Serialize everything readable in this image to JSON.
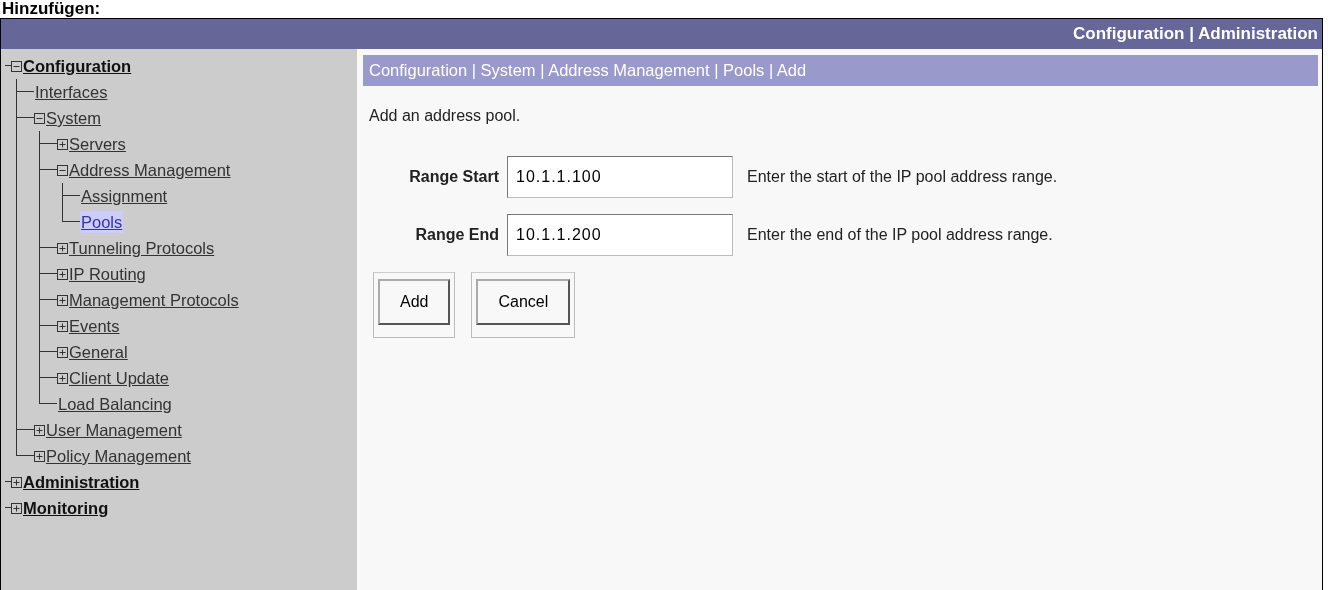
{
  "caption": "Hinzufügen:",
  "header": {
    "text": "Configuration | Administration"
  },
  "tree": [
    {
      "label": "Configuration",
      "selected": false,
      "expanded": true,
      "children": [
        {
          "label": "Interfaces",
          "selected": false
        },
        {
          "label": "System",
          "selected": false,
          "expanded": true,
          "children": [
            {
              "label": "Servers",
              "selected": false,
              "expanded": false
            },
            {
              "label": "Address Management",
              "selected": false,
              "expanded": true,
              "children": [
                {
                  "label": "Assignment",
                  "selected": false
                },
                {
                  "label": "Pools",
                  "selected": true
                }
              ]
            },
            {
              "label": "Tunneling Protocols",
              "selected": false,
              "expanded": false
            },
            {
              "label": "IP Routing",
              "selected": false,
              "expanded": false
            },
            {
              "label": "Management Protocols",
              "selected": false,
              "expanded": false
            },
            {
              "label": "Events",
              "selected": false,
              "expanded": false
            },
            {
              "label": "General",
              "selected": false,
              "expanded": false
            },
            {
              "label": "Client Update",
              "selected": false,
              "expanded": false
            },
            {
              "label": "Load Balancing",
              "selected": false
            }
          ]
        },
        {
          "label": "User Management",
          "selected": false,
          "expanded": false
        },
        {
          "label": "Policy Management",
          "selected": false,
          "expanded": false
        }
      ]
    },
    {
      "label": "Administration",
      "selected": false,
      "expanded": false
    },
    {
      "label": "Monitoring",
      "selected": false,
      "expanded": false
    }
  ],
  "breadcrumb": "Configuration | System | Address Management | Pools | Add",
  "intro": "Add an address pool.",
  "fields": [
    {
      "label": "Range Start",
      "value": "10.1.1.100",
      "hint": "Enter the start of the IP pool address range."
    },
    {
      "label": "Range End",
      "value": "10.1.1.200",
      "hint": "Enter the end of the IP pool address range."
    }
  ],
  "buttons": [
    "Add",
    "Cancel"
  ]
}
